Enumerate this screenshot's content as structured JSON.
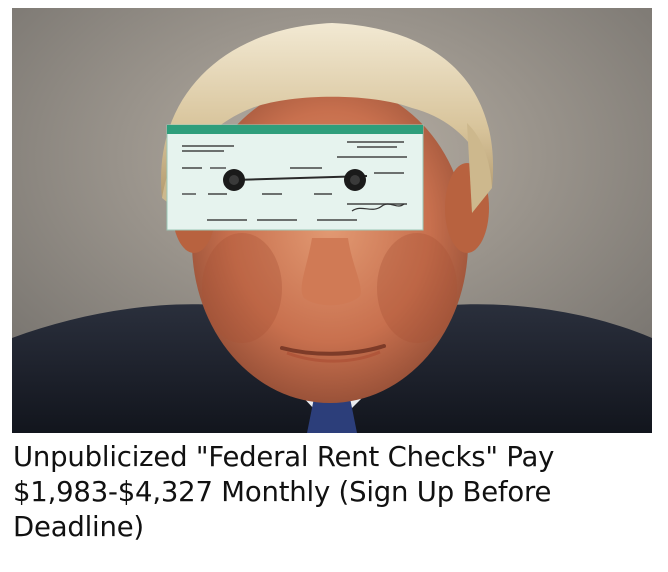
{
  "ad": {
    "headline_lines": [
      "Unpublicized \"Federal Rent Checks\" Pay",
      "$1,983-$4,327 Monthly (Sign Up Before",
      "Deadline)"
    ]
  },
  "colors": {
    "check_band": "#2f9e7b",
    "check_paper": "#e6f3ee",
    "check_ink": "#222222"
  }
}
